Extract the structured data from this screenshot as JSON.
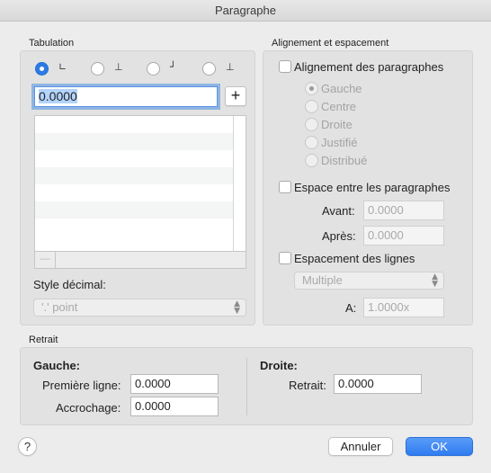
{
  "window": {
    "title": "Paragraphe"
  },
  "tabulation": {
    "label": "Tabulation",
    "position_value": "0.0000",
    "add_button": "+",
    "remove_button": "—",
    "decimal_style_label": "Style décimal:",
    "decimal_style_value": "'.' point",
    "tab_types": [
      {
        "icon": "left-tab-icon",
        "glyph": "∟",
        "selected": true
      },
      {
        "icon": "center-tab-icon",
        "glyph": "⊥",
        "selected": false
      },
      {
        "icon": "right-tab-icon",
        "glyph": "┘",
        "selected": false
      },
      {
        "icon": "decimal-tab-icon",
        "glyph": "⊥",
        "selected": false
      }
    ]
  },
  "alignment": {
    "section_label": "Alignement et espacement",
    "paragraph_alignment_label": "Alignement des paragraphes",
    "paragraph_alignment_checked": false,
    "options": [
      "Gauche",
      "Centre",
      "Droite",
      "Justifié",
      "Distribué"
    ],
    "selected_option": "Gauche",
    "paragraph_spacing_label": "Espace entre les paragraphes",
    "before_label": "Avant:",
    "before_value": "0.0000",
    "after_label": "Après:",
    "after_value": "0.0000",
    "line_spacing_label": "Espacement des lignes",
    "line_spacing_mode": "Multiple",
    "a_label": "A:",
    "a_value": "1.0000x"
  },
  "indent": {
    "section_label": "Retrait",
    "left_title": "Gauche:",
    "first_line_label": "Première ligne:",
    "first_line_value": "0.0000",
    "hanging_label": "Accrochage:",
    "hanging_value": "0.0000",
    "right_title": "Droite:",
    "right_indent_label": "Retrait:",
    "right_indent_value": "0.0000"
  },
  "footer": {
    "help": "?",
    "cancel": "Annuler",
    "ok": "OK"
  },
  "colors": {
    "accent": "#2f7cf0",
    "focus_ring": "#5a95e6"
  }
}
